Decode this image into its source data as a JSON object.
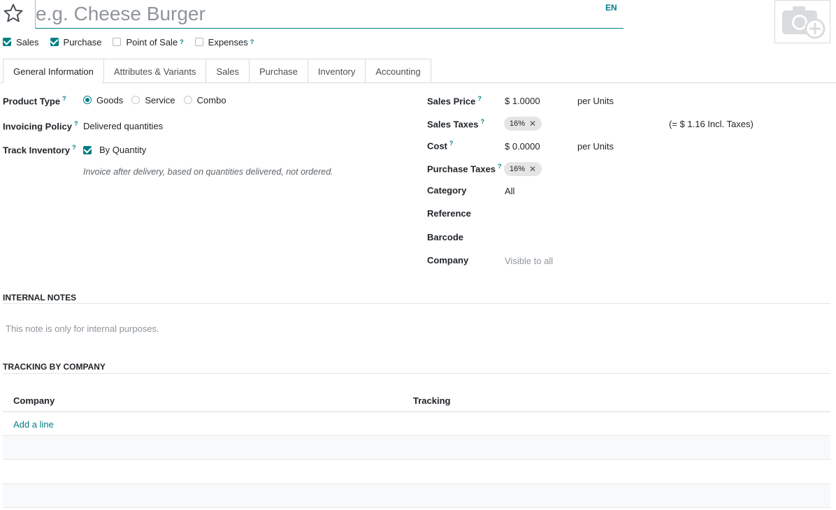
{
  "header": {
    "name_placeholder": "e.g. Cheese Burger",
    "lang": "EN",
    "favorite_icon": "star-icon",
    "image_icon": "camera-plus-icon"
  },
  "options": [
    {
      "label": "Sales",
      "checked": true,
      "help": false
    },
    {
      "label": "Purchase",
      "checked": true,
      "help": false
    },
    {
      "label": "Point of Sale",
      "checked": false,
      "help": true
    },
    {
      "label": "Expenses",
      "checked": false,
      "help": true
    }
  ],
  "tabs": [
    "General Information",
    "Attributes & Variants",
    "Sales",
    "Purchase",
    "Inventory",
    "Accounting"
  ],
  "general": {
    "product_type": {
      "label": "Product Type",
      "options": [
        "Goods",
        "Service",
        "Combo"
      ],
      "selected": "Goods"
    },
    "invoicing_policy": {
      "label": "Invoicing Policy",
      "value": "Delivered quantities"
    },
    "track_inventory": {
      "label": "Track Inventory",
      "value": "By Quantity",
      "checked": true
    },
    "hint": "Invoice after delivery, based on quantities delivered, not ordered."
  },
  "pricing": {
    "sales_price": {
      "label": "Sales Price",
      "value": "$ 1.0000",
      "unit": "per Units"
    },
    "sales_taxes": {
      "label": "Sales Taxes",
      "tag": "16%",
      "incl": "(= $ 1.16 Incl. Taxes)"
    },
    "cost": {
      "label": "Cost",
      "value": "$ 0.0000",
      "unit": "per Units"
    },
    "purchase_taxes": {
      "label": "Purchase Taxes",
      "tag": "16%"
    },
    "category": {
      "label": "Category",
      "value": "All"
    },
    "reference": {
      "label": "Reference"
    },
    "barcode": {
      "label": "Barcode"
    },
    "company": {
      "label": "Company",
      "placeholder": "Visible to all"
    }
  },
  "notes": {
    "title": "INTERNAL NOTES",
    "placeholder": "This note is only for internal purposes."
  },
  "tracking": {
    "title": "TRACKING BY COMPANY",
    "columns": [
      "Company",
      "Tracking"
    ],
    "add_line": "Add a line"
  },
  "colors": {
    "accent": "#017e84",
    "border": "#d8dadd",
    "tag_bg": "#e7e4e6"
  }
}
